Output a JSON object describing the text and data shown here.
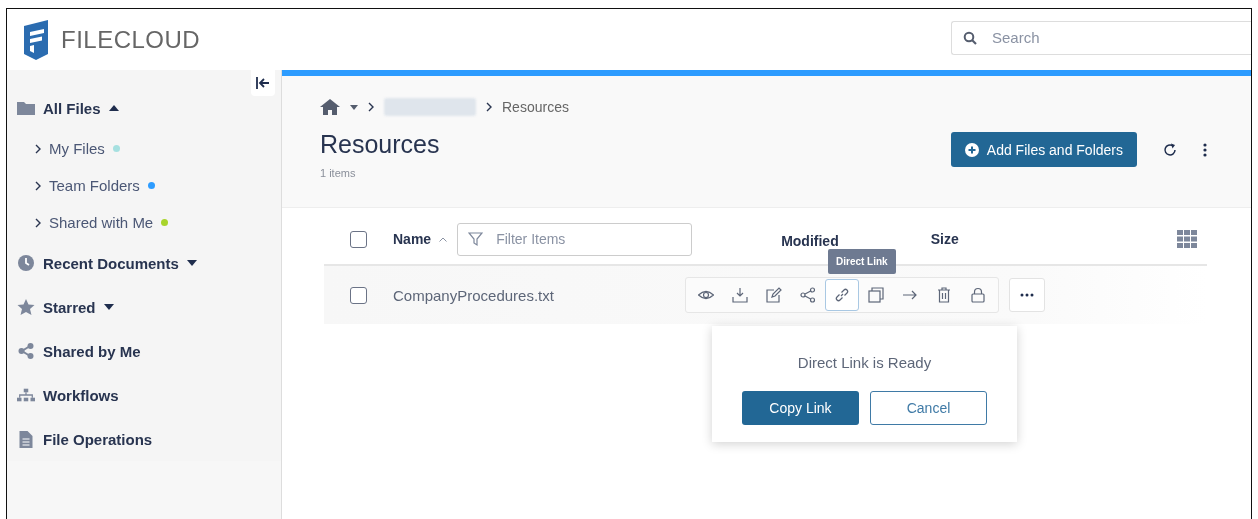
{
  "header": {
    "logo_text": "FILECLOUD",
    "search": {
      "placeholder": "Search"
    }
  },
  "sidebar": {
    "items": [
      {
        "kind": "folder",
        "label": "All Files",
        "expanded": true,
        "children": [
          {
            "label": "My Files",
            "color": "#a6e0e0"
          },
          {
            "label": "Team Folders",
            "color": "#2d9cff"
          },
          {
            "label": "Shared with Me",
            "color": "#a8d42b"
          }
        ]
      },
      {
        "kind": "clock",
        "label": "Recent Documents",
        "expanded": false
      },
      {
        "kind": "star",
        "label": "Starred",
        "expanded": false
      },
      {
        "kind": "share",
        "label": "Shared by Me"
      },
      {
        "kind": "tree",
        "label": "Workflows"
      },
      {
        "kind": "file",
        "label": "File Operations"
      }
    ]
  },
  "breadcrumb": {
    "current": "Resources"
  },
  "page": {
    "title": "Resources",
    "count": "1 items",
    "add_button": "Add Files and Folders"
  },
  "table": {
    "select_all_checked": false,
    "columns": [
      "Name",
      "Modified",
      "Size"
    ],
    "filter": {
      "placeholder": "Filter Items"
    },
    "rows": [
      {
        "name": "CompanyProcedures.txt",
        "checked": false,
        "actions": [
          {
            "kind": "view",
            "selected": false
          },
          {
            "kind": "download",
            "selected": false
          },
          {
            "kind": "edit",
            "selected": false
          },
          {
            "kind": "share",
            "selected": false
          },
          {
            "kind": "link",
            "selected": true
          },
          {
            "kind": "copy",
            "selected": false
          },
          {
            "kind": "move",
            "selected": false
          },
          {
            "kind": "delete",
            "selected": false
          },
          {
            "kind": "lock",
            "selected": false
          }
        ]
      }
    ]
  },
  "tooltip": "Direct Link",
  "popup": {
    "message": "Direct Link is Ready",
    "buttons": [
      "Copy Link",
      "Cancel"
    ]
  }
}
